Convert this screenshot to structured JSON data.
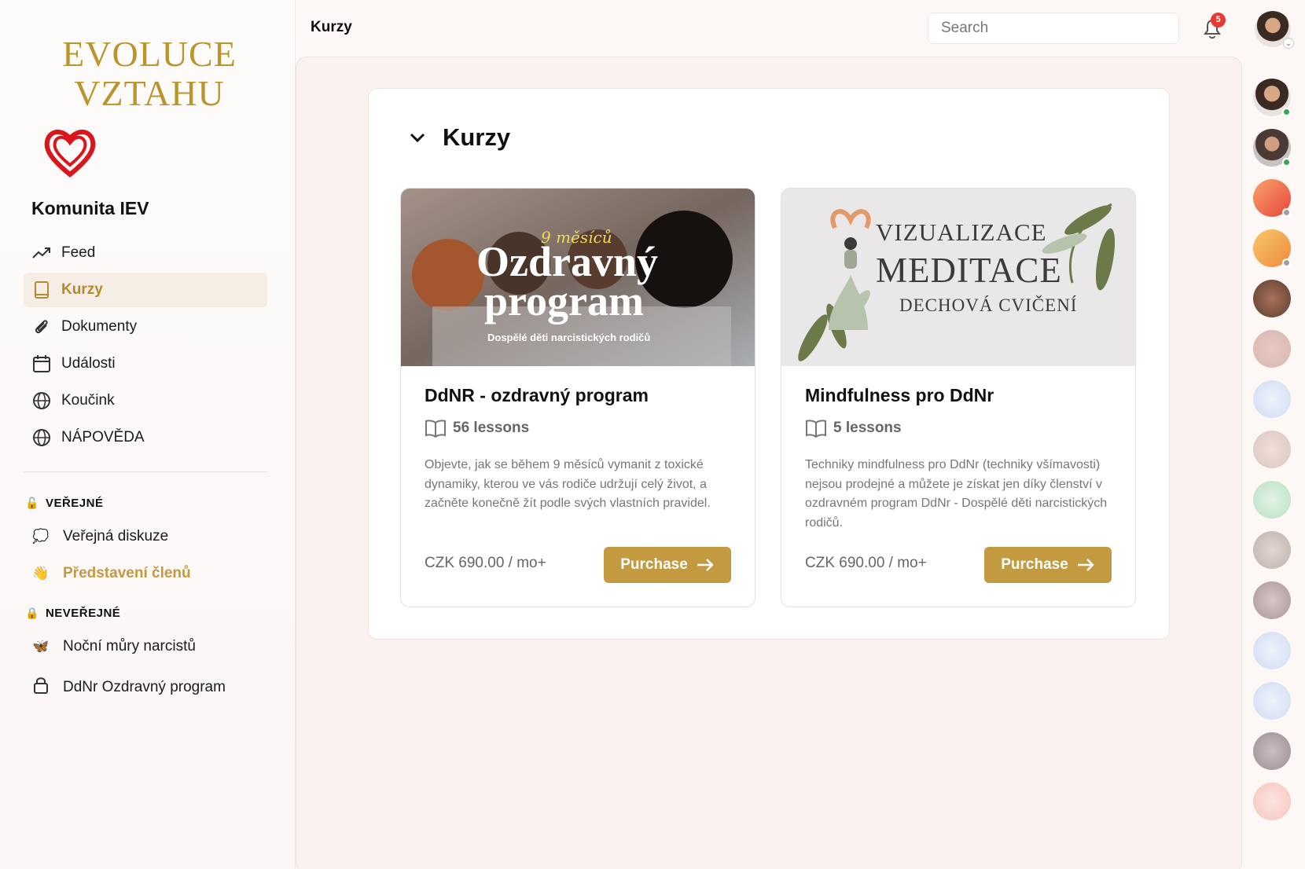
{
  "brand": {
    "line1": "EVOLUCE",
    "line2": "VZTAHU"
  },
  "community": {
    "name": "Komunita IEV"
  },
  "nav": {
    "items": [
      {
        "label": "Feed",
        "icon": "trending-icon"
      },
      {
        "label": "Kurzy",
        "icon": "book-icon",
        "active": true
      },
      {
        "label": "Dokumenty",
        "icon": "paperclip-icon"
      },
      {
        "label": "Události",
        "icon": "calendar-icon"
      },
      {
        "label": "Koučink",
        "icon": "globe-icon"
      },
      {
        "label": "NÁPOVĚDA",
        "icon": "globe-icon"
      }
    ]
  },
  "sections": {
    "public": {
      "title": "VEŘEJNÉ",
      "items": [
        {
          "label": "Veřejná diskuze",
          "icon": "speech-bubble-icon"
        },
        {
          "label": "Představení členů",
          "icon": "waving-hand-icon",
          "highlight": true
        }
      ]
    },
    "private": {
      "title": "NEVEŘEJNÉ",
      "items": [
        {
          "label": "Noční můry narcistů",
          "icon": "butterfly-icon"
        },
        {
          "label": "DdNr Ozdravný program",
          "icon": "lock-icon"
        }
      ]
    }
  },
  "header": {
    "title": "Kurzy",
    "search_placeholder": "Search",
    "notifications_count": "5"
  },
  "main": {
    "section_title": "Kurzy",
    "courses": [
      {
        "title": "DdNR - ozdravný program",
        "lessons": "56 lessons",
        "description": "Objevte, jak se během 9 měsíců vymanit z toxické dynamiky, kterou ve vás rodiče udržují celý život, a začněte konečně žít podle svých vlastních pravidel.",
        "price": "CZK 690.00 / mo+",
        "button": "Purchase",
        "thumb": {
          "script": "9 měsíců",
          "title1": "Ozdravný",
          "title2": "program",
          "subtitle": "Dospělé děti narcistických rodičů"
        }
      },
      {
        "title": "Mindfulness pro DdNr",
        "lessons": "5 lessons",
        "description": "Techniky mindfulness pro DdNr (techniky všímavosti) nejsou prodejné a můžete je získat jen díky členství v ozdravném program DdNr - Dospělé děti narcistických rodičů.",
        "price": "CZK 690.00 / mo+",
        "button": "Purchase",
        "thumb": {
          "line1": "VIZUALIZACE",
          "line2": "MEDITACE",
          "line3": "DECHOVÁ CVIČENÍ"
        }
      }
    ]
  },
  "colors": {
    "accent": "#c49a40",
    "brand_gold": "#b9952b",
    "badge": "#e53935",
    "online": "#34a853"
  }
}
